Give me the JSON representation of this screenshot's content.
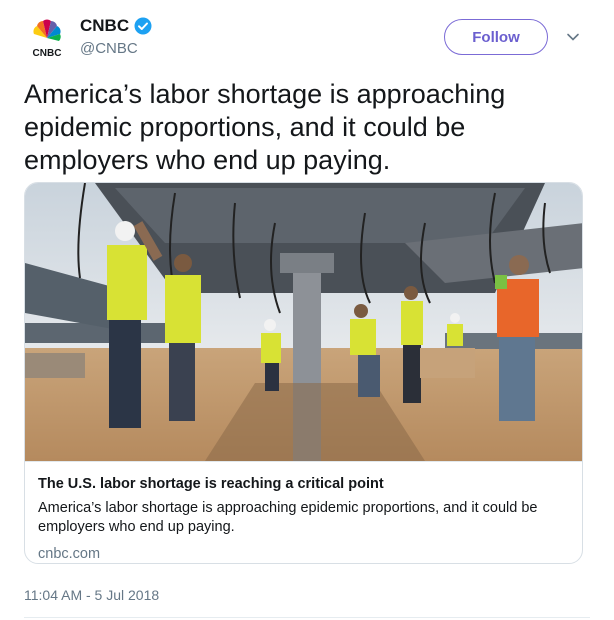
{
  "author": {
    "display_name": "CNBC",
    "handle": "@CNBC",
    "logo_text": "CNBC",
    "verified_icon": "verified-badge-icon",
    "brand_color": "#1da1f2"
  },
  "follow_label": "Follow",
  "tweet_text": "America’s labor shortage is approaching epidemic proportions, and it could be employers who end up paying.",
  "card": {
    "title": "The U.S. labor shortage is reaching a critical point",
    "description": "America’s labor shortage is approaching epidemic proportions, and it could be employers who end up paying.",
    "domain": "cnbc.com"
  },
  "timestamp": "11:04 AM - 5 Jul 2018",
  "colors": {
    "follow_accent": "#6b5fcf",
    "secondary_text": "#657786"
  }
}
